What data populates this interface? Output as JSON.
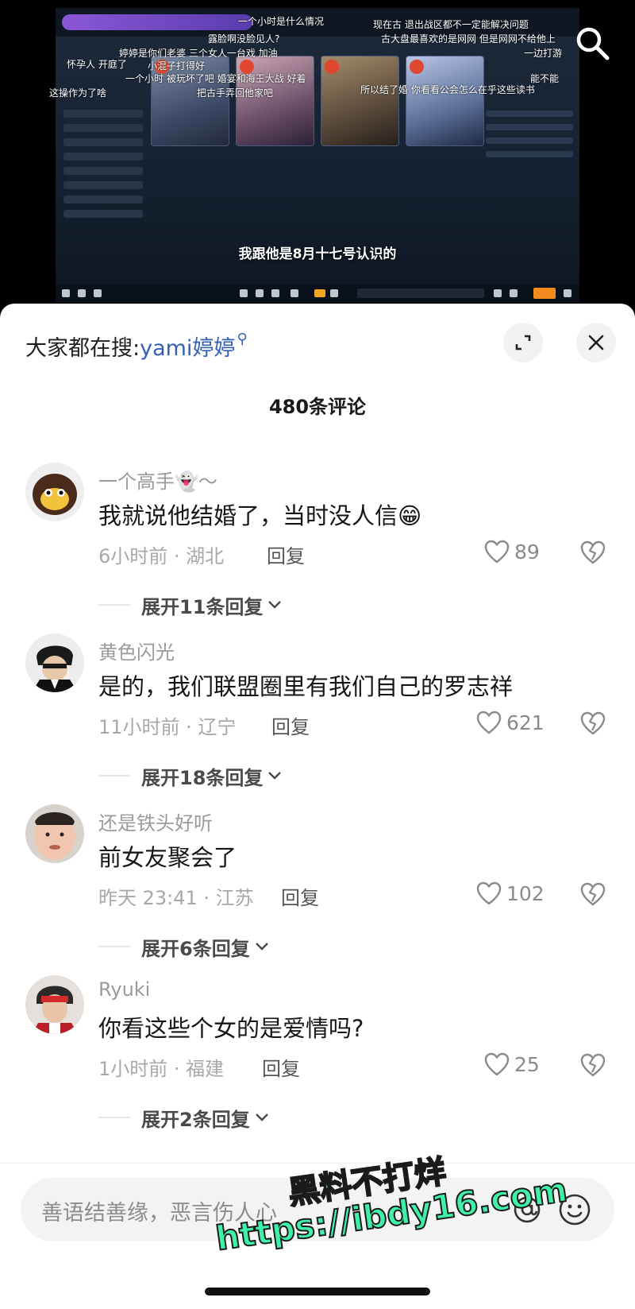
{
  "video": {
    "subtitle": "我跟他是8月十七号认识的",
    "overlay_texts": [
      "一个小时是什么情况",
      "现在古 退出战区都不一定能解决问题",
      "露脸啊没脸见人?",
      "古大盘最喜欢的是网网 但是网网不给他上",
      "怀孕人 开庭了",
      "小混子打得好",
      "一个小时 被玩坏了吧 婚宴和海王大战 好着",
      "婷婷是你们老婆 三个女人一台戏 加油",
      "一边打游",
      "把古手弄回他家吧",
      "所以结了婚 你看看公会怎么在乎这些读书",
      "能不能",
      "这操作为了啥"
    ]
  },
  "search_hint": {
    "prefix": "大家都在搜:",
    "keyword": "yami婷婷"
  },
  "comment_count": "480条评论",
  "comments": [
    {
      "username": "一个高手👻～",
      "text": "我就说他结婚了，当时没人信😁",
      "meta": "6小时前 · 湖北",
      "reply_label": "回复",
      "likes": "89",
      "expand": "展开11条回复"
    },
    {
      "username": "黄色闪光",
      "text": "是的，我们联盟圈里有我们自己的罗志祥",
      "meta": "11小时前 · 辽宁",
      "reply_label": "回复",
      "likes": "621",
      "expand": "展开18条回复"
    },
    {
      "username": "还是铁头好听",
      "text": "前女友聚会了",
      "meta": "昨天 23:41 · 江苏",
      "reply_label": "回复",
      "likes": "102",
      "expand": "展开6条回复"
    },
    {
      "username": "Ryuki",
      "text": "你看这些个女的是爱情吗?",
      "meta": "1小时前 · 福建",
      "reply_label": "回复",
      "likes": "25",
      "expand": "展开2条回复"
    }
  ],
  "input": {
    "placeholder": "善语结善缘，恶言伤人心"
  },
  "watermark": {
    "line1": "黑料不打烊",
    "line2": "https://ibdy16.com"
  },
  "icons": [
    "search-icon",
    "expand-icon",
    "close-icon",
    "heart-icon",
    "dislike-icon",
    "chevron-down-icon",
    "at-icon",
    "emoji-icon"
  ],
  "colors": {
    "keyword_blue": "#3360b5",
    "watermark_green": "#3ef0a8"
  }
}
